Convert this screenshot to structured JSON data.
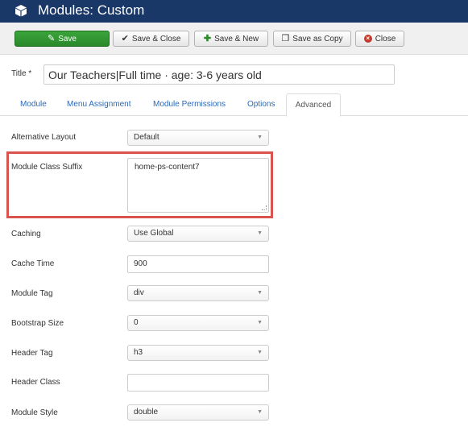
{
  "header": {
    "title": "Modules: Custom",
    "background": "#1a3867"
  },
  "toolbar": {
    "save_label": "Save",
    "save_close_label": "Save & Close",
    "save_new_label": "Save & New",
    "save_copy_label": "Save as Copy",
    "close_label": "Close",
    "save_color": "#2a882a",
    "close_icon_color": "#c23a2e"
  },
  "title_field": {
    "label": "Title *",
    "value": "Our Teachers|Full time · age: 3-6 years old"
  },
  "tabs": [
    {
      "label": "Module"
    },
    {
      "label": "Menu Assignment"
    },
    {
      "label": "Module Permissions"
    },
    {
      "label": "Options"
    },
    {
      "label": "Advanced",
      "active": true
    }
  ],
  "fields": {
    "alt_layout": {
      "label": "Alternative Layout",
      "value": "Default"
    },
    "class_suffix": {
      "label": "Module Class Suffix",
      "value": "home-ps-content7",
      "highlight_color": "#d9534f"
    },
    "caching": {
      "label": "Caching",
      "value": "Use Global"
    },
    "cache_time": {
      "label": "Cache Time",
      "value": "900"
    },
    "module_tag": {
      "label": "Module Tag",
      "value": "div"
    },
    "bootstrap_size": {
      "label": "Bootstrap Size",
      "value": "0"
    },
    "header_tag": {
      "label": "Header Tag",
      "value": "h3"
    },
    "header_class": {
      "label": "Header Class",
      "value": ""
    },
    "module_style": {
      "label": "Module Style",
      "value": "double"
    }
  }
}
